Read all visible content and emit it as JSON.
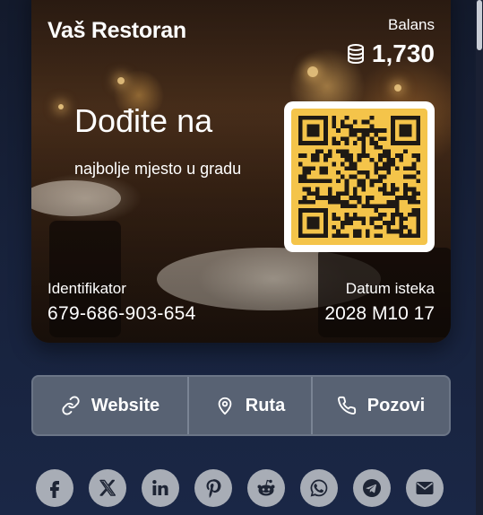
{
  "card": {
    "title": "Vaš Restoran",
    "balance_label": "Balans",
    "balance_value": "1,730",
    "promo_title": "Dođite na",
    "promo_subtitle": "najbolje mjesto u gradu",
    "identifier_label": "Identifikator",
    "identifier_value": "679-686-903-654",
    "expiry_label": "Datum isteka",
    "expiry_value": "2028 M10 17",
    "qr_color": "#f4c44a"
  },
  "actions": [
    {
      "label": "Website",
      "icon": "link-icon"
    },
    {
      "label": "Ruta",
      "icon": "map-pin-icon"
    },
    {
      "label": "Pozovi",
      "icon": "phone-icon"
    }
  ],
  "social": [
    {
      "icon": "facebook-icon"
    },
    {
      "icon": "x-twitter-icon"
    },
    {
      "icon": "linkedin-icon"
    },
    {
      "icon": "pinterest-icon"
    },
    {
      "icon": "reddit-icon"
    },
    {
      "icon": "whatsapp-icon"
    },
    {
      "icon": "telegram-icon"
    },
    {
      "icon": "email-icon"
    }
  ],
  "colors": {
    "page_background": "#17213a",
    "button_background": "#586273",
    "social_background": "#a8adb6",
    "social_icon": "#1e2535"
  }
}
